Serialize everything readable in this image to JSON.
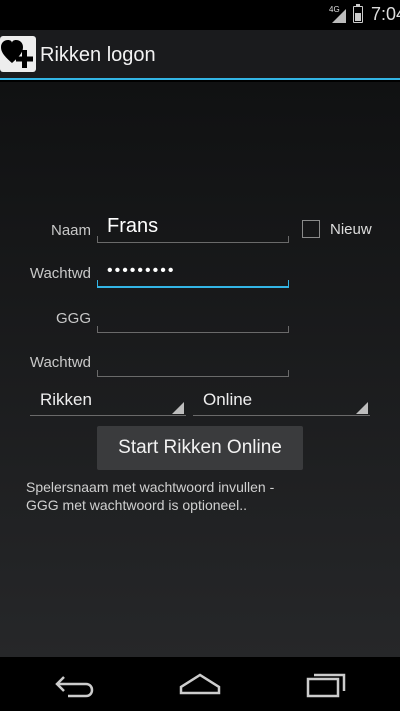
{
  "status_bar": {
    "network": "4G",
    "time": "7:04"
  },
  "app": {
    "title": "Rikken logon",
    "icon": "heart-plus-icon"
  },
  "form": {
    "naam_label": "Naam",
    "naam_value": "Frans",
    "nieuw_label": "Nieuw",
    "nieuw_checked": false,
    "wachtwd1_label": "Wachtwd",
    "wachtwd1_value": "•••••••••",
    "ggg_label": "GGG",
    "ggg_value": "",
    "wachtwd2_label": "Wachtwd",
    "wachtwd2_value": "",
    "spinner_game": "Rikken",
    "spinner_mode": "Online",
    "start_button": "Start Rikken Online",
    "hint_line1": "Spelersnaam met wachtwoord invullen -",
    "hint_line2": "GGG met wachtwoord is optioneel.."
  },
  "nav": {
    "back": "back-icon",
    "home": "home-icon",
    "recents": "recents-icon"
  },
  "colors": {
    "accent": "#33b5e5",
    "background": "#1a1b1d"
  }
}
